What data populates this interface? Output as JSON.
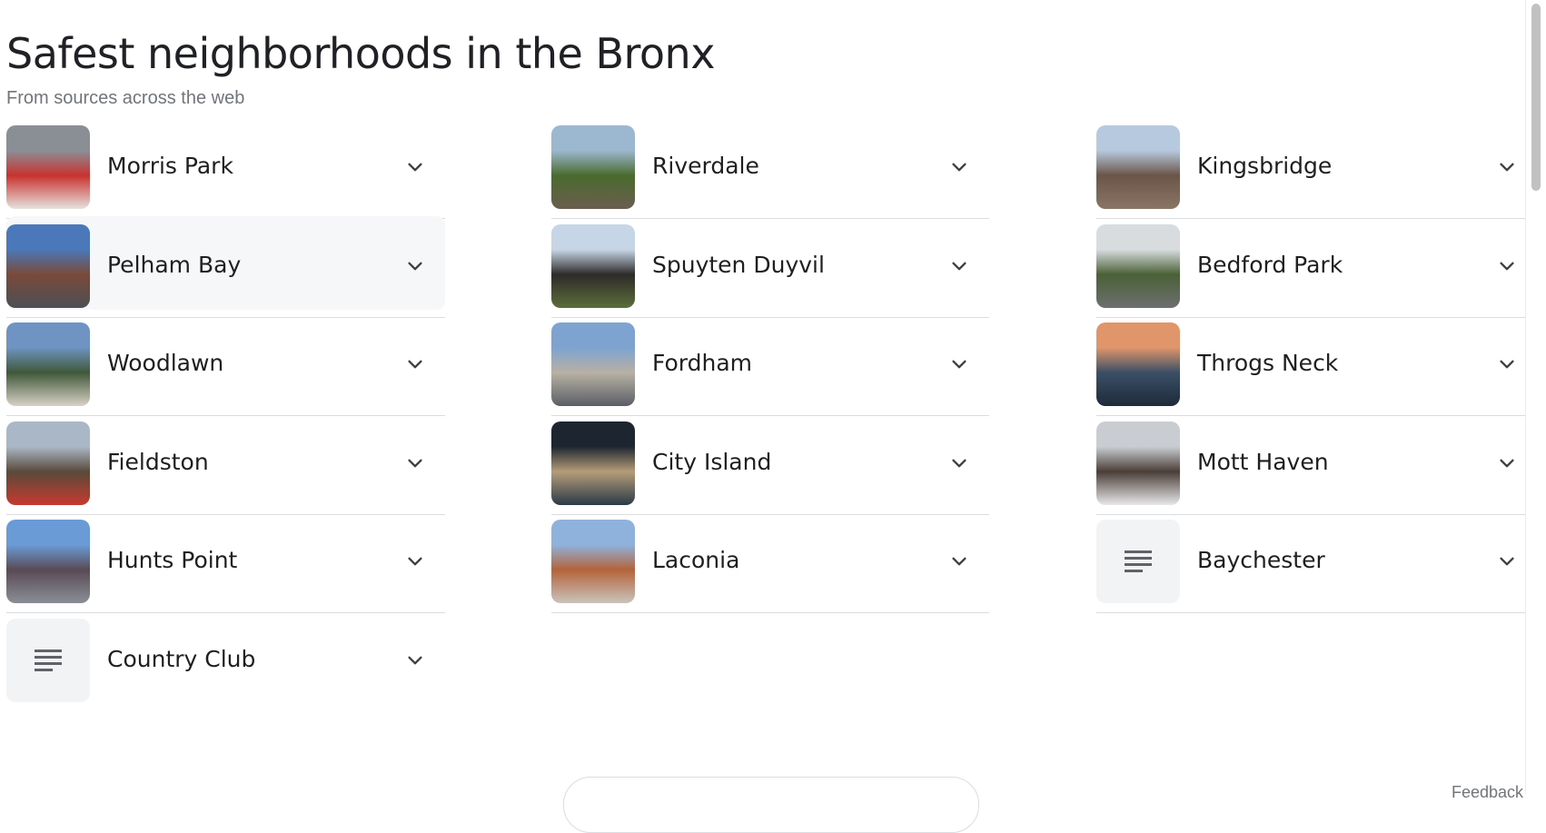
{
  "title": "Safest neighborhoods in the Bronx",
  "subtitle": "From sources across the web",
  "columns": [
    {
      "items": [
        {
          "label": "Morris Park",
          "thumb": "photo",
          "palette": [
            "#8a8f96",
            "#c8322f",
            "#e6e2dc"
          ]
        },
        {
          "label": "Pelham Bay",
          "thumb": "photo",
          "palette": [
            "#4a78b8",
            "#7a4a3a",
            "#4b4f54"
          ]
        },
        {
          "label": "Woodlawn",
          "thumb": "photo",
          "palette": [
            "#6f93c2",
            "#40583a",
            "#d8d2c6"
          ]
        },
        {
          "label": "Fieldston",
          "thumb": "photo",
          "palette": [
            "#a9b7c6",
            "#5a4a3a",
            "#c63a2e"
          ]
        },
        {
          "label": "Hunts Point",
          "thumb": "photo",
          "palette": [
            "#6a9bd6",
            "#5a4a55",
            "#8a8f96"
          ]
        },
        {
          "label": "Country Club",
          "thumb": "doc-icon",
          "palette": []
        }
      ]
    },
    {
      "items": [
        {
          "label": "Riverdale",
          "thumb": "photo",
          "palette": [
            "#9cb7d0",
            "#4a6b2e",
            "#6b5d4f"
          ]
        },
        {
          "label": "Spuyten Duyvil",
          "thumb": "photo",
          "palette": [
            "#c7d6e6",
            "#2e2b2a",
            "#5c6e3a"
          ]
        },
        {
          "label": "Fordham",
          "thumb": "photo",
          "palette": [
            "#7ea3d1",
            "#b8b0a4",
            "#5a5f66"
          ]
        },
        {
          "label": "City Island",
          "thumb": "photo",
          "palette": [
            "#1d2630",
            "#b59c78",
            "#2b3a48"
          ]
        },
        {
          "label": "Laconia",
          "thumb": "photo",
          "palette": [
            "#8fb2dd",
            "#b5633b",
            "#c9c4bb"
          ]
        }
      ]
    },
    {
      "items": [
        {
          "label": "Kingsbridge",
          "thumb": "photo",
          "palette": [
            "#b7c9de",
            "#6a5548",
            "#8a7565"
          ]
        },
        {
          "label": "Bedford Park",
          "thumb": "photo",
          "palette": [
            "#d8dcdf",
            "#4a6136",
            "#6d6f70"
          ]
        },
        {
          "label": "Throgs Neck",
          "thumb": "photo",
          "palette": [
            "#e0956a",
            "#3a4f66",
            "#1e2b3a"
          ]
        },
        {
          "label": "Mott Haven",
          "thumb": "photo",
          "palette": [
            "#c9cdd2",
            "#4b3e38",
            "#e8e8ea"
          ]
        },
        {
          "label": "Baychester",
          "thumb": "doc-icon",
          "palette": []
        }
      ]
    }
  ],
  "icons": {
    "expand": "chevron-down-icon",
    "document": "document-lines-icon"
  },
  "colors": {
    "divider": "#dadce0",
    "hover_bg": "#f6f7f9",
    "text": "#1f1f1f",
    "subtle": "#70757a"
  },
  "highlighted_item": "Pelham Bay",
  "footer_hint": "Feedback"
}
